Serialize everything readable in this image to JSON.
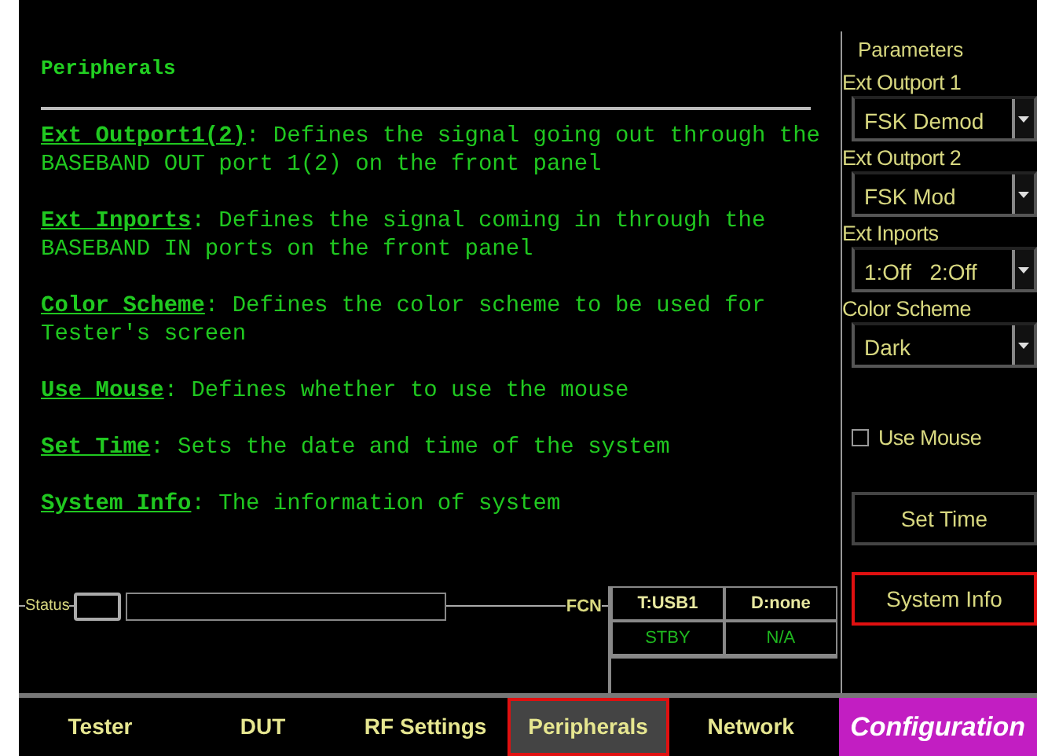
{
  "heading": "Peripherals",
  "descriptions": [
    {
      "term": "Ext Outport1(2)",
      "text": ": Defines the signal going out through the BASEBAND OUT port 1(2) on the front panel"
    },
    {
      "term": "Ext Inports",
      "text": ": Defines the signal coming in through the BASEBAND IN ports on the front panel"
    },
    {
      "term": "Color Scheme",
      "text": ": Defines the color scheme to be used for Tester's screen"
    },
    {
      "term": "Use Mouse",
      "text": ": Defines whether to use the mouse"
    },
    {
      "term": "Set Time",
      "text": ": Sets the date and time of the system"
    },
    {
      "term": "System Info",
      "text": ": The information of system"
    }
  ],
  "parameters": {
    "title": "Parameters",
    "fields": [
      {
        "kind": "select",
        "label": "Ext Outport 1",
        "value": "FSK Demod"
      },
      {
        "kind": "select",
        "label": "Ext Outport 2",
        "value": "FSK Mod"
      },
      {
        "kind": "select",
        "label": "Ext Inports",
        "value": "1:Off   2:Off"
      },
      {
        "kind": "select",
        "label": "Color Scheme",
        "value": "Dark"
      },
      {
        "kind": "checkbox",
        "label": "Use Mouse",
        "checked": false
      },
      {
        "kind": "button",
        "label": "Set Time",
        "highlighted": false
      },
      {
        "kind": "button",
        "label": "System Info",
        "highlighted": true
      }
    ]
  },
  "status": {
    "label": "Status",
    "fcn_label": "FCN",
    "cells": [
      {
        "kind": "header",
        "text": "T:USB1"
      },
      {
        "kind": "header",
        "text": "D:none"
      },
      {
        "kind": "value",
        "text": "STBY"
      },
      {
        "kind": "value",
        "text": "N/A"
      }
    ]
  },
  "tabs": [
    {
      "label": "Tester",
      "kind": "tab",
      "selected": false
    },
    {
      "label": "DUT",
      "kind": "tab",
      "selected": false
    },
    {
      "label": "RF Settings",
      "kind": "tab",
      "selected": false
    },
    {
      "label": "Peripherals",
      "kind": "tab",
      "selected": true
    },
    {
      "label": "Network",
      "kind": "tab",
      "selected": false
    },
    {
      "label": "Configuration",
      "kind": "mode",
      "selected": false
    }
  ]
}
